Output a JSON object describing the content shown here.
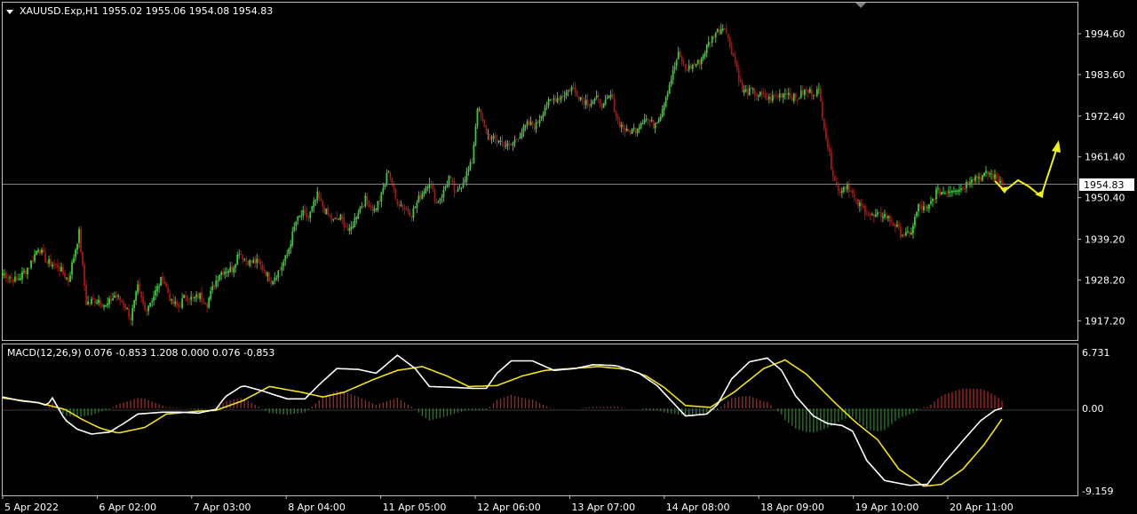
{
  "header": {
    "symbol_text": "XAUUSD.Exp,H1  1955.02 1955.06 1954.08 1954.83",
    "collapse_icon": "triangle-down-icon"
  },
  "macd": {
    "label": "MACD(12,26,9) 0.076 -0.853 1.208 0.000 0.076 -0.853"
  },
  "colors": {
    "background": "#000000",
    "frame": "#c0c0c0",
    "bull": "#32d12e",
    "bear": "#b01010",
    "signal": "#f0e020",
    "macd_line": "#ffffff",
    "hist_pos": "#a52020",
    "hist_neg": "#1f7a1f",
    "price_line": "#808080",
    "arrow": "#f0f020",
    "bid_tag_bg": "#ffffff",
    "bid_tag_fg": "#000000"
  },
  "chart_data": [
    {
      "type": "candlestick",
      "title": "XAUUSD.Exp,H1",
      "ohlc_last": {
        "open": 1955.02,
        "high": 1955.06,
        "low": 1954.08,
        "close": 1954.83
      },
      "current_price": "1954.83",
      "ylim": [
        1912.0,
        2003.0
      ],
      "y_ticks": [
        "1994.60",
        "1983.60",
        "1972.40",
        "1961.40",
        "1950.40",
        "1939.20",
        "1928.20",
        "1917.20"
      ],
      "x_ticks": [
        "5 Apr 2022",
        "6 Apr 02:00",
        "7 Apr 03:00",
        "8 Apr 04:00",
        "11 Apr 05:00",
        "12 Apr 06:00",
        "13 Apr 07:00",
        "14 Apr 08:00",
        "18 Apr 09:00",
        "19 Apr 10:00",
        "20 Apr 11:00"
      ],
      "close_path": [
        [
          0,
          1930
        ],
        [
          8,
          1928
        ],
        [
          15,
          1932
        ],
        [
          20,
          1937
        ],
        [
          25,
          1933
        ],
        [
          31,
          1932
        ],
        [
          37,
          1928
        ],
        [
          43,
          1941
        ],
        [
          47,
          1922
        ],
        [
          54,
          1923
        ],
        [
          58,
          1921
        ],
        [
          63,
          1924
        ],
        [
          68,
          1922
        ],
        [
          72,
          1918
        ],
        [
          76,
          1926
        ],
        [
          80,
          1920
        ],
        [
          85,
          1924
        ],
        [
          90,
          1929
        ],
        [
          95,
          1922
        ],
        [
          99,
          1921
        ],
        [
          103,
          1924
        ],
        [
          107,
          1923
        ],
        [
          111,
          1924
        ],
        [
          115,
          1922
        ],
        [
          119,
          1927
        ],
        [
          122,
          1930
        ],
        [
          126,
          1931
        ],
        [
          129,
          1931
        ],
        [
          133,
          1936
        ],
        [
          136,
          1934
        ],
        [
          139,
          1933
        ],
        [
          143,
          1933
        ],
        [
          147,
          1931
        ],
        [
          151,
          1928
        ],
        [
          156,
          1931
        ],
        [
          160,
          1935
        ],
        [
          165,
          1944
        ],
        [
          169,
          1946
        ],
        [
          172,
          1945
        ],
        [
          177,
          1951
        ],
        [
          181,
          1947
        ],
        [
          186,
          1944
        ],
        [
          190,
          1945
        ],
        [
          195,
          1941
        ],
        [
          200,
          1947
        ],
        [
          204,
          1950
        ],
        [
          209,
          1947
        ],
        [
          213,
          1951
        ],
        [
          217,
          1958
        ],
        [
          221,
          1950
        ],
        [
          225,
          1948
        ],
        [
          230,
          1946
        ],
        [
          235,
          1951
        ],
        [
          240,
          1955
        ],
        [
          244,
          1949
        ],
        [
          248,
          1952
        ],
        [
          251,
          1956
        ],
        [
          255,
          1951
        ],
        [
          259,
          1955
        ],
        [
          264,
          1960
        ],
        [
          267,
          1975
        ],
        [
          271,
          1969
        ],
        [
          275,
          1966
        ],
        [
          279,
          1966
        ],
        [
          285,
          1964
        ],
        [
          290,
          1967
        ],
        [
          295,
          1970
        ],
        [
          300,
          1970
        ],
        [
          305,
          1975
        ],
        [
          310,
          1977
        ],
        [
          315,
          1978
        ],
        [
          320,
          1980
        ],
        [
          326,
          1977
        ],
        [
          330,
          1976
        ],
        [
          334,
          1977
        ],
        [
          338,
          1975
        ],
        [
          342,
          1978
        ],
        [
          346,
          1971
        ],
        [
          351,
          1968
        ],
        [
          356,
          1969
        ],
        [
          361,
          1972
        ],
        [
          366,
          1970
        ],
        [
          370,
          1973
        ],
        [
          375,
          1981
        ],
        [
          380,
          1989
        ],
        [
          384,
          1985
        ],
        [
          388,
          1986
        ],
        [
          392,
          1987
        ],
        [
          397,
          1992
        ],
        [
          401,
          1995
        ],
        [
          404,
          1996
        ],
        [
          406,
          1997
        ],
        [
          408,
          1993
        ],
        [
          412,
          1987
        ],
        [
          416,
          1979
        ],
        [
          421,
          1979
        ],
        [
          426,
          1978
        ],
        [
          431,
          1977
        ],
        [
          436,
          1978
        ],
        [
          441,
          1979
        ],
        [
          446,
          1977
        ],
        [
          451,
          1979
        ],
        [
          455,
          1979
        ],
        [
          459,
          1979
        ],
        [
          463,
          1967
        ],
        [
          466,
          1959
        ],
        [
          470,
          1952
        ],
        [
          475,
          1954
        ],
        [
          480,
          1949
        ],
        [
          485,
          1947
        ],
        [
          490,
          1945
        ],
        [
          495,
          1946
        ],
        [
          500,
          1944
        ],
        [
          505,
          1941
        ],
        [
          510,
          1940
        ],
        [
          515,
          1948
        ],
        [
          520,
          1947
        ],
        [
          525,
          1952
        ],
        [
          530,
          1952
        ],
        [
          535,
          1953
        ],
        [
          540,
          1953
        ],
        [
          545,
          1956
        ],
        [
          550,
          1956
        ],
        [
          555,
          1957
        ],
        [
          560,
          1955
        ],
        [
          563,
          1955
        ]
      ]
    },
    {
      "type": "line",
      "title": "MACD(12,26,9)",
      "ylim": [
        -9.159,
        6.731
      ],
      "y_ticks": [
        "6.731",
        "0.00",
        "-9.159"
      ],
      "series": [
        {
          "name": "MACD",
          "role": "macd",
          "points": [
            [
              0,
              1.2
            ],
            [
              10,
              0.8
            ],
            [
              20,
              0.6
            ],
            [
              25,
              0.3
            ],
            [
              28,
              1.1
            ],
            [
              35,
              -1.2
            ],
            [
              42,
              -2.2
            ],
            [
              50,
              -2.7
            ],
            [
              60,
              -2.5
            ],
            [
              68,
              -1.6
            ],
            [
              76,
              -0.6
            ],
            [
              90,
              -0.4
            ],
            [
              100,
              -0.4
            ],
            [
              110,
              -0.5
            ],
            [
              120,
              -0.1
            ],
            [
              125,
              1.2
            ],
            [
              135,
              2.4
            ],
            [
              145,
              1.9
            ],
            [
              160,
              1.0
            ],
            [
              170,
              1.0
            ],
            [
              178,
              2.5
            ],
            [
              188,
              4.2
            ],
            [
              200,
              4.1
            ],
            [
              210,
              3.7
            ],
            [
              222,
              5.6
            ],
            [
              232,
              4.2
            ],
            [
              240,
              2.3
            ],
            [
              255,
              2.2
            ],
            [
              265,
              2.1
            ],
            [
              272,
              2.1
            ],
            [
              278,
              3.7
            ],
            [
              286,
              5.0
            ],
            [
              298,
              5.0
            ],
            [
              310,
              4.0
            ],
            [
              322,
              4.2
            ],
            [
              332,
              4.6
            ],
            [
              345,
              4.5
            ],
            [
              358,
              3.7
            ],
            [
              368,
              2.4
            ],
            [
              378,
              0.4
            ],
            [
              384,
              -0.8
            ],
            [
              396,
              -0.6
            ],
            [
              402,
              0.4
            ],
            [
              410,
              3.1
            ],
            [
              420,
              4.9
            ],
            [
              430,
              5.3
            ],
            [
              438,
              4.0
            ],
            [
              446,
              1.3
            ],
            [
              456,
              -0.8
            ],
            [
              464,
              -1.6
            ],
            [
              472,
              -1.8
            ],
            [
              478,
              -2.4
            ],
            [
              486,
              -5.5
            ],
            [
              496,
              -7.6
            ],
            [
              510,
              -8.1
            ],
            [
              520,
              -8.0
            ],
            [
              530,
              -5.6
            ],
            [
              540,
              -3.4
            ],
            [
              550,
              -1.3
            ],
            [
              558,
              -0.2
            ],
            [
              563,
              0.076
            ]
          ]
        },
        {
          "name": "Signal",
          "role": "signal",
          "points": [
            [
              0,
              1.1
            ],
            [
              20,
              0.6
            ],
            [
              35,
              -0.1
            ],
            [
              45,
              -1.2
            ],
            [
              55,
              -2.1
            ],
            [
              65,
              -2.6
            ],
            [
              80,
              -2.0
            ],
            [
              92,
              -0.6
            ],
            [
              110,
              -0.3
            ],
            [
              120,
              -0.2
            ],
            [
              135,
              0.8
            ],
            [
              150,
              2.3
            ],
            [
              168,
              1.7
            ],
            [
              180,
              1.2
            ],
            [
              192,
              1.7
            ],
            [
              208,
              3.0
            ],
            [
              222,
              4.0
            ],
            [
              236,
              4.4
            ],
            [
              250,
              3.4
            ],
            [
              262,
              2.3
            ],
            [
              278,
              2.4
            ],
            [
              292,
              3.4
            ],
            [
              305,
              4.0
            ],
            [
              320,
              4.2
            ],
            [
              335,
              4.4
            ],
            [
              352,
              4.1
            ],
            [
              362,
              3.4
            ],
            [
              372,
              2.2
            ],
            [
              384,
              0.3
            ],
            [
              398,
              0.1
            ],
            [
              412,
              1.8
            ],
            [
              428,
              4.2
            ],
            [
              440,
              5.1
            ],
            [
              452,
              3.6
            ],
            [
              468,
              0.6
            ],
            [
              480,
              -1.5
            ],
            [
              492,
              -3.3
            ],
            [
              504,
              -6.4
            ],
            [
              518,
              -8.2
            ],
            [
              528,
              -8.0
            ],
            [
              540,
              -6.4
            ],
            [
              552,
              -3.8
            ],
            [
              563,
              -0.853
            ]
          ]
        }
      ]
    }
  ]
}
